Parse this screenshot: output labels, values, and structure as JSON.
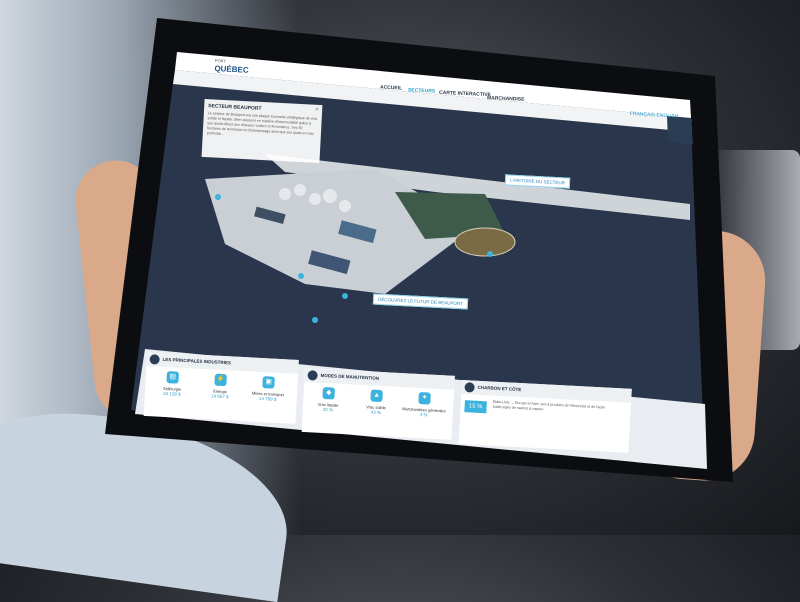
{
  "brand": {
    "line1": "PORT",
    "line2": "QUÉBEC"
  },
  "nav": [
    {
      "label": "ACCUEIL",
      "active": false
    },
    {
      "label": "SECTEURS",
      "active": true
    },
    {
      "label": "CARTE INTERACTIVE",
      "active": false
    },
    {
      "label": "MARCHANDISE",
      "active": false
    }
  ],
  "lang": "FRANÇAIS  ENGLISH",
  "info": {
    "title": "SECTEUR BEAUPORT",
    "body": "Le secteur de Beauport est une plaque tournante stratégique de vrac solide et liquide. Bien desservi en matière d'intermodalité grâce à ses accès direct aux réseaux routiers et ferroviaires. Ses 50 hectares de terminaux et d'entreposage ainsi que ses quais en eau profonde..."
  },
  "callouts": {
    "history": "L'HISTOIRE DU SECTEUR",
    "future": "DÉCOUVREZ LE FUTUR DE BEAUPORT"
  },
  "panels": {
    "industries": {
      "title": "LES PRINCIPALES INDUSTRIES",
      "stats": [
        {
          "name": "Sidérurgie",
          "value": "34 128 $"
        },
        {
          "name": "Énergie",
          "value": "14 857 $"
        },
        {
          "name": "Mines et transport",
          "value": "14 789 $"
        }
      ]
    },
    "modes": {
      "title": "MODES DE MANUTENTION",
      "stats": [
        {
          "name": "Vrac liquide",
          "value": "20 %"
        },
        {
          "name": "Vrac solide",
          "value": "43 %"
        },
        {
          "name": "Marchandises générales",
          "value": "3 %"
        }
      ]
    },
    "charbon": {
      "title": "CHARBON ET CÔTE",
      "percent": "15 %",
      "body": "États-Unis → Europe et Asie; sert à produire de l'électricité et de l'acier (sidérurgie) de navires à vapeur."
    }
  }
}
